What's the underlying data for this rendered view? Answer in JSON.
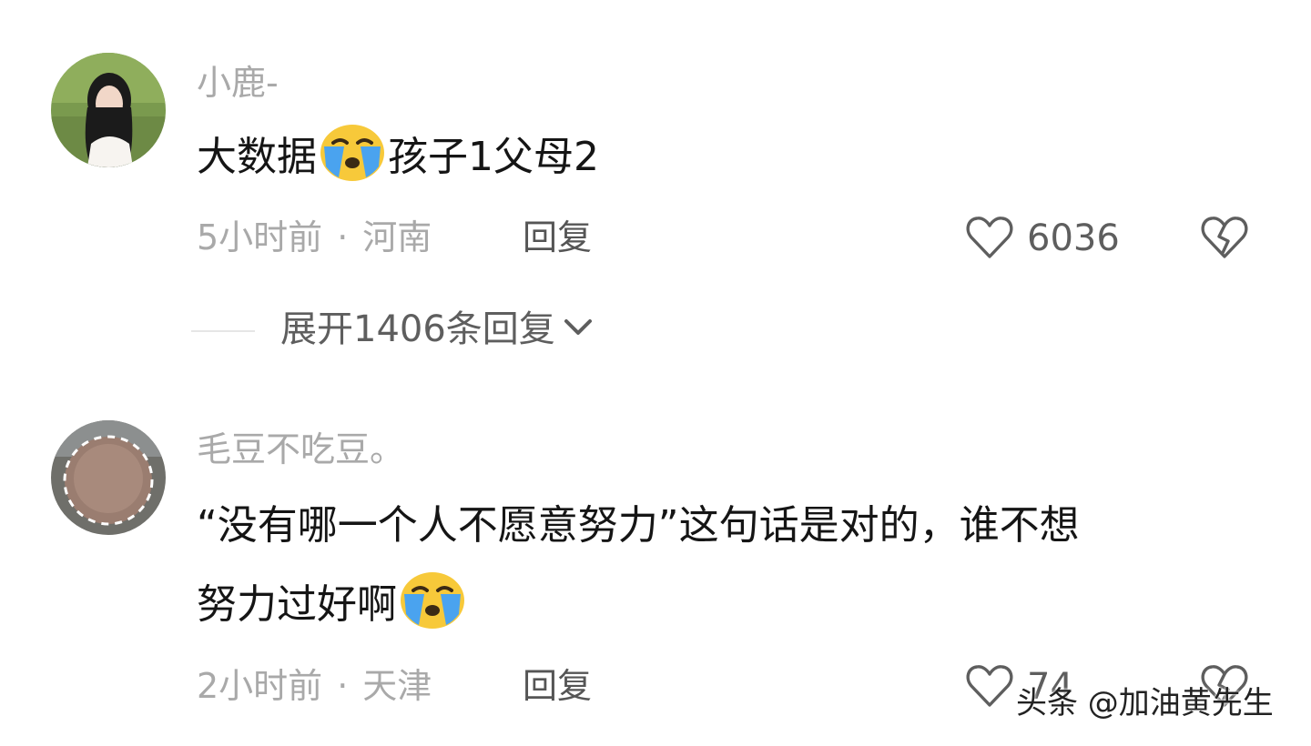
{
  "comments": [
    {
      "username": "小鹿-",
      "content_before": "大数据",
      "content_after": "孩子1父母2",
      "emoji_icon": "loudly-crying-face-emoji",
      "time": "5小时前",
      "separator": "·",
      "location": "河南",
      "reply_label": "回复",
      "like_count": "6036",
      "replies_toggle": "展开1406条回复"
    },
    {
      "username": "毛豆不吃豆。",
      "content_line1": "“没有哪一个人不愿意努力”这句话是对的，谁不想",
      "content_line2": "努力过好啊",
      "emoji_icon": "loudly-crying-face-emoji",
      "time": "2小时前",
      "separator": "·",
      "location": "天津",
      "reply_label": "回复",
      "like_count": "74"
    }
  ],
  "watermark": "头条 @加油黄先生",
  "colors": {
    "meta_gray": "#a9a9a9",
    "text_dark": "#151515",
    "icon_gray": "#5e5e5e",
    "emoji_yellow": "#f7c93a",
    "emoji_tear_blue": "#4aa3ef"
  }
}
